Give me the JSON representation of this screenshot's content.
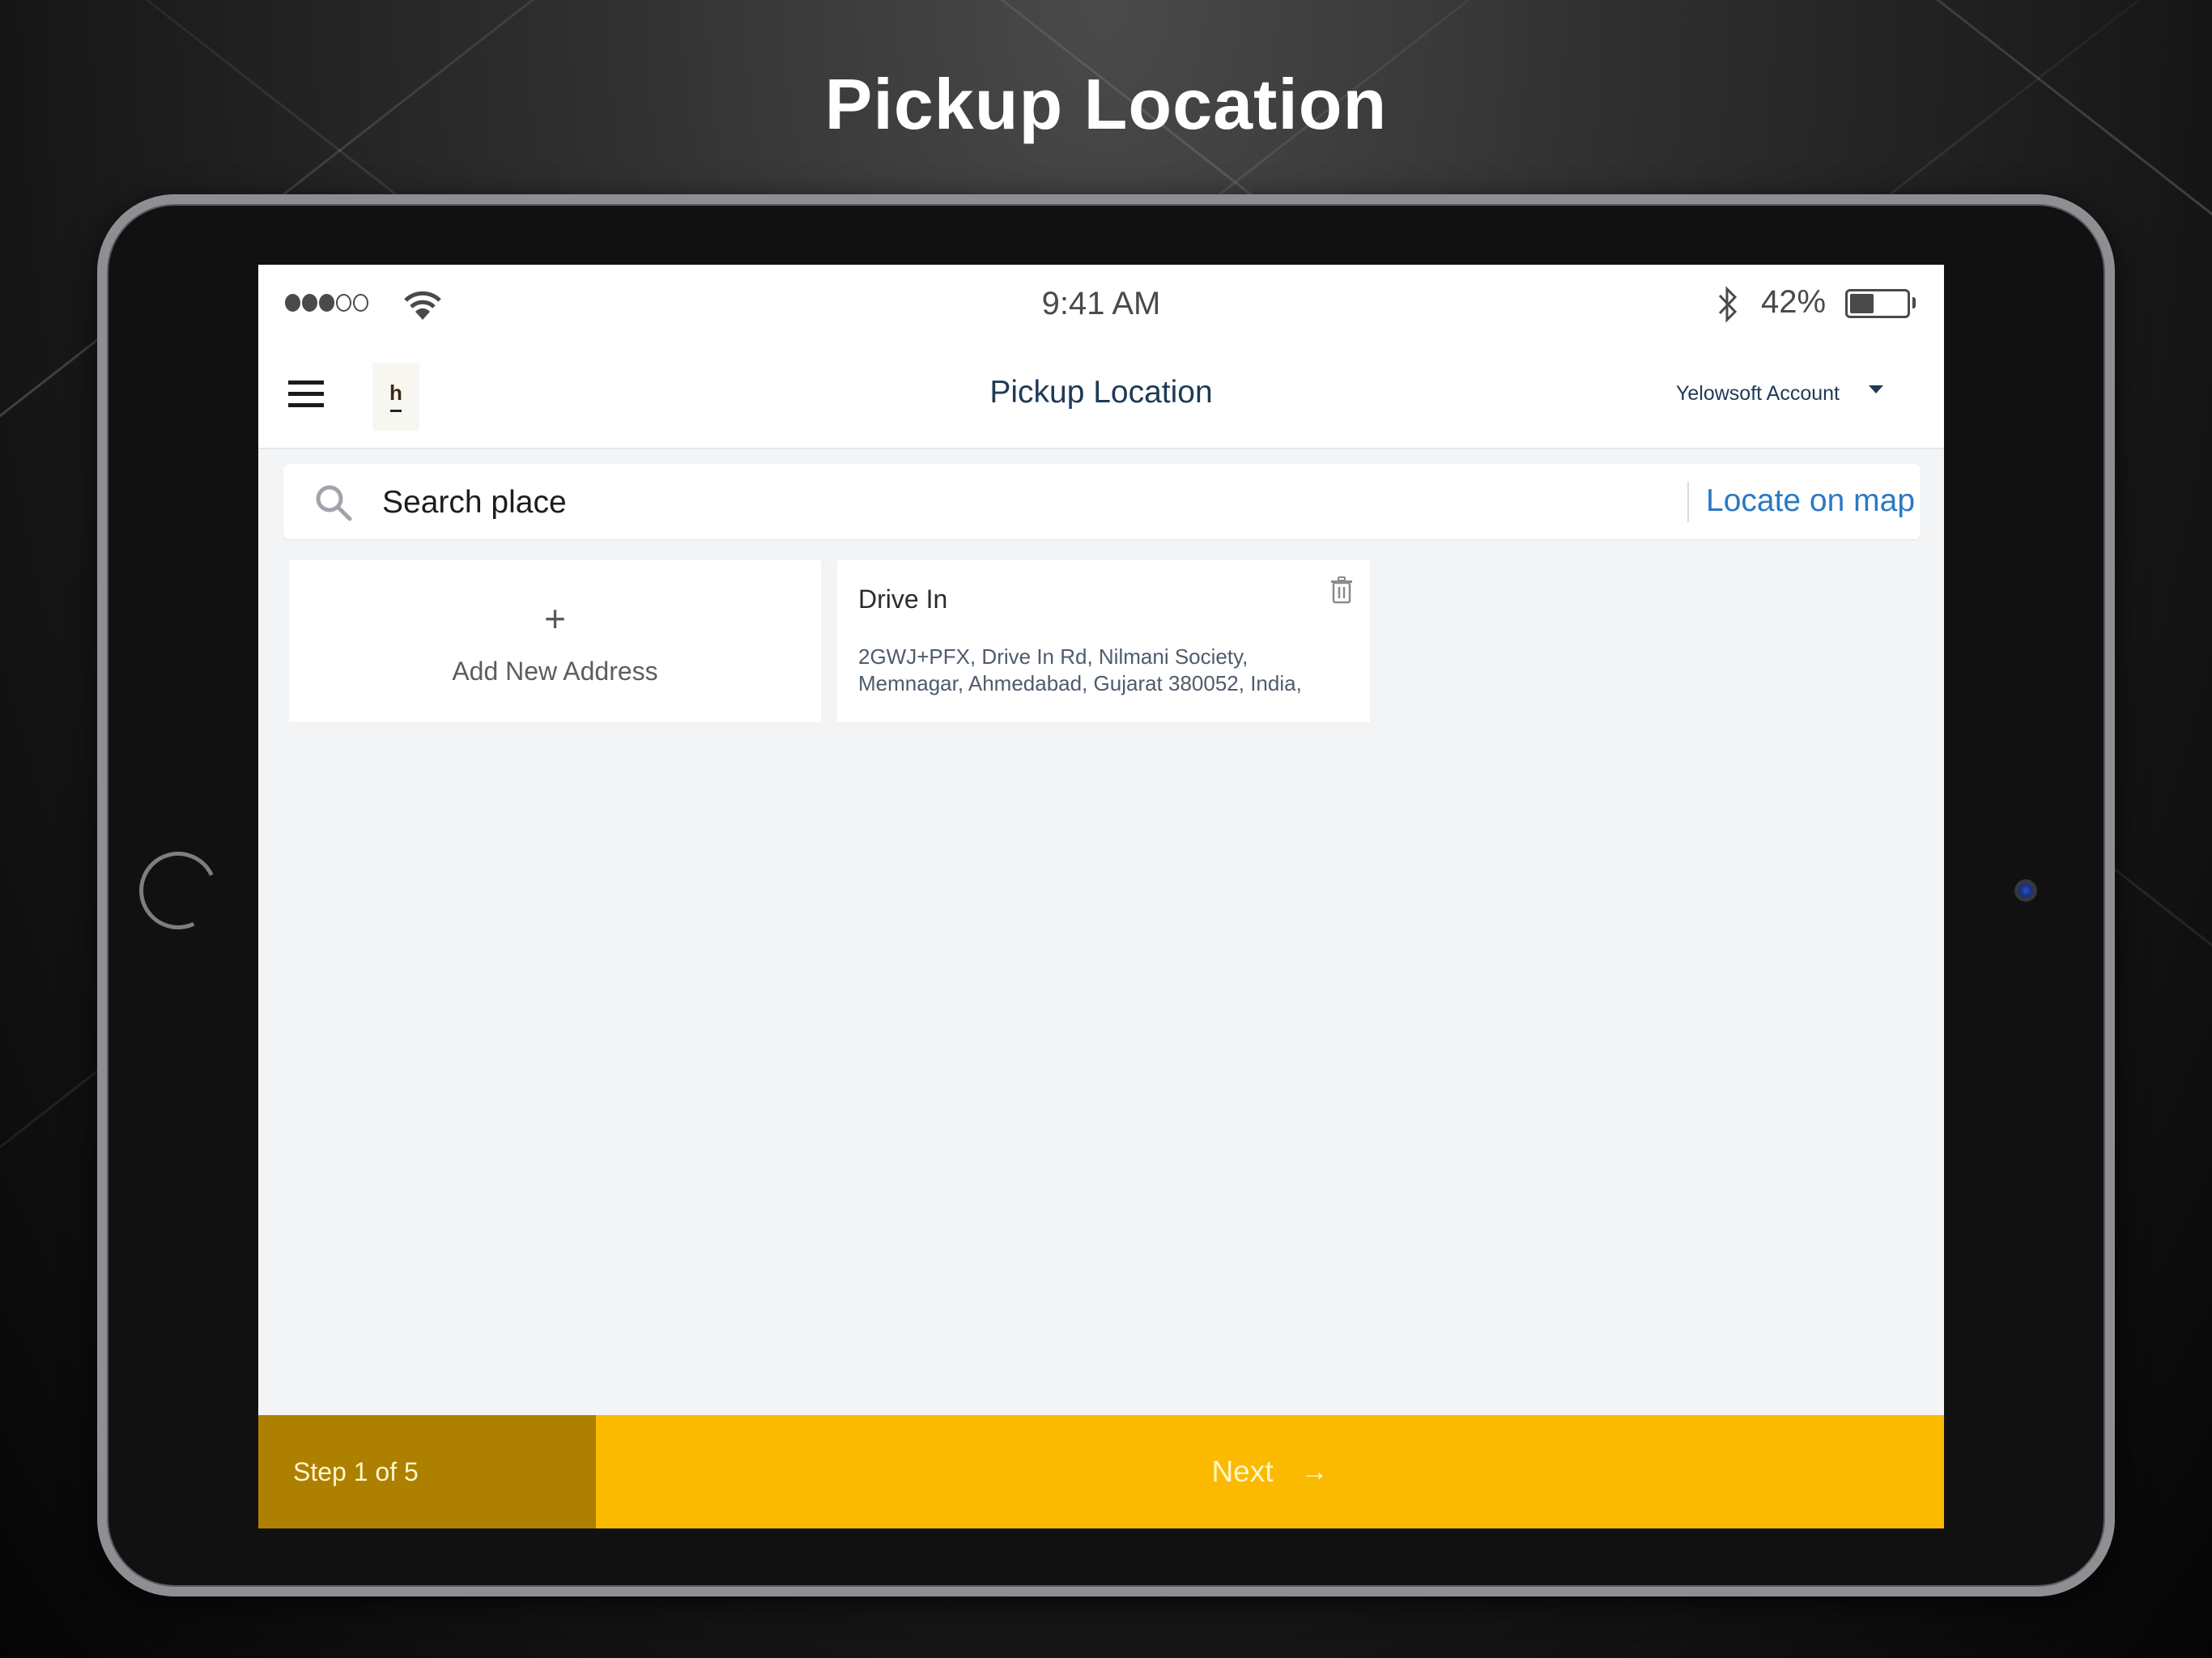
{
  "promo": {
    "title": "Pickup Location"
  },
  "status_bar": {
    "signal_bars_filled": 3,
    "signal_bars_total": 5,
    "time": "9:41 AM",
    "battery_percent_label": "42%",
    "battery_level": 0.42,
    "icons": [
      "signal-dots-icon",
      "wifi-icon",
      "bluetooth-icon",
      "battery-icon"
    ]
  },
  "header": {
    "menu_icon": "hamburger-icon",
    "logo_mark": "h",
    "title": "Pickup Location",
    "account_label": "Yelowsoft Account"
  },
  "search": {
    "placeholder": "Search place",
    "value": "",
    "locate_label": "Locate on map"
  },
  "addresses": {
    "add_label": "Add New Address",
    "add_icon": "+",
    "items": [
      {
        "name": "Drive In",
        "line1": "2GWJ+PFX, Drive In Rd, Nilmani Society,",
        "line2": "Memnagar, Ahmedabad, Gujarat 380052, India,"
      }
    ]
  },
  "footer": {
    "step_label": "Step 1 of 5",
    "next_label": "Next",
    "next_arrow": "→"
  },
  "colors": {
    "accent_yellow": "#FBBA00",
    "step_dark_yellow": "#AE8000",
    "link_blue": "#2A79C4",
    "title_navy": "#1E3A56",
    "content_bg": "#F3F4F6"
  }
}
